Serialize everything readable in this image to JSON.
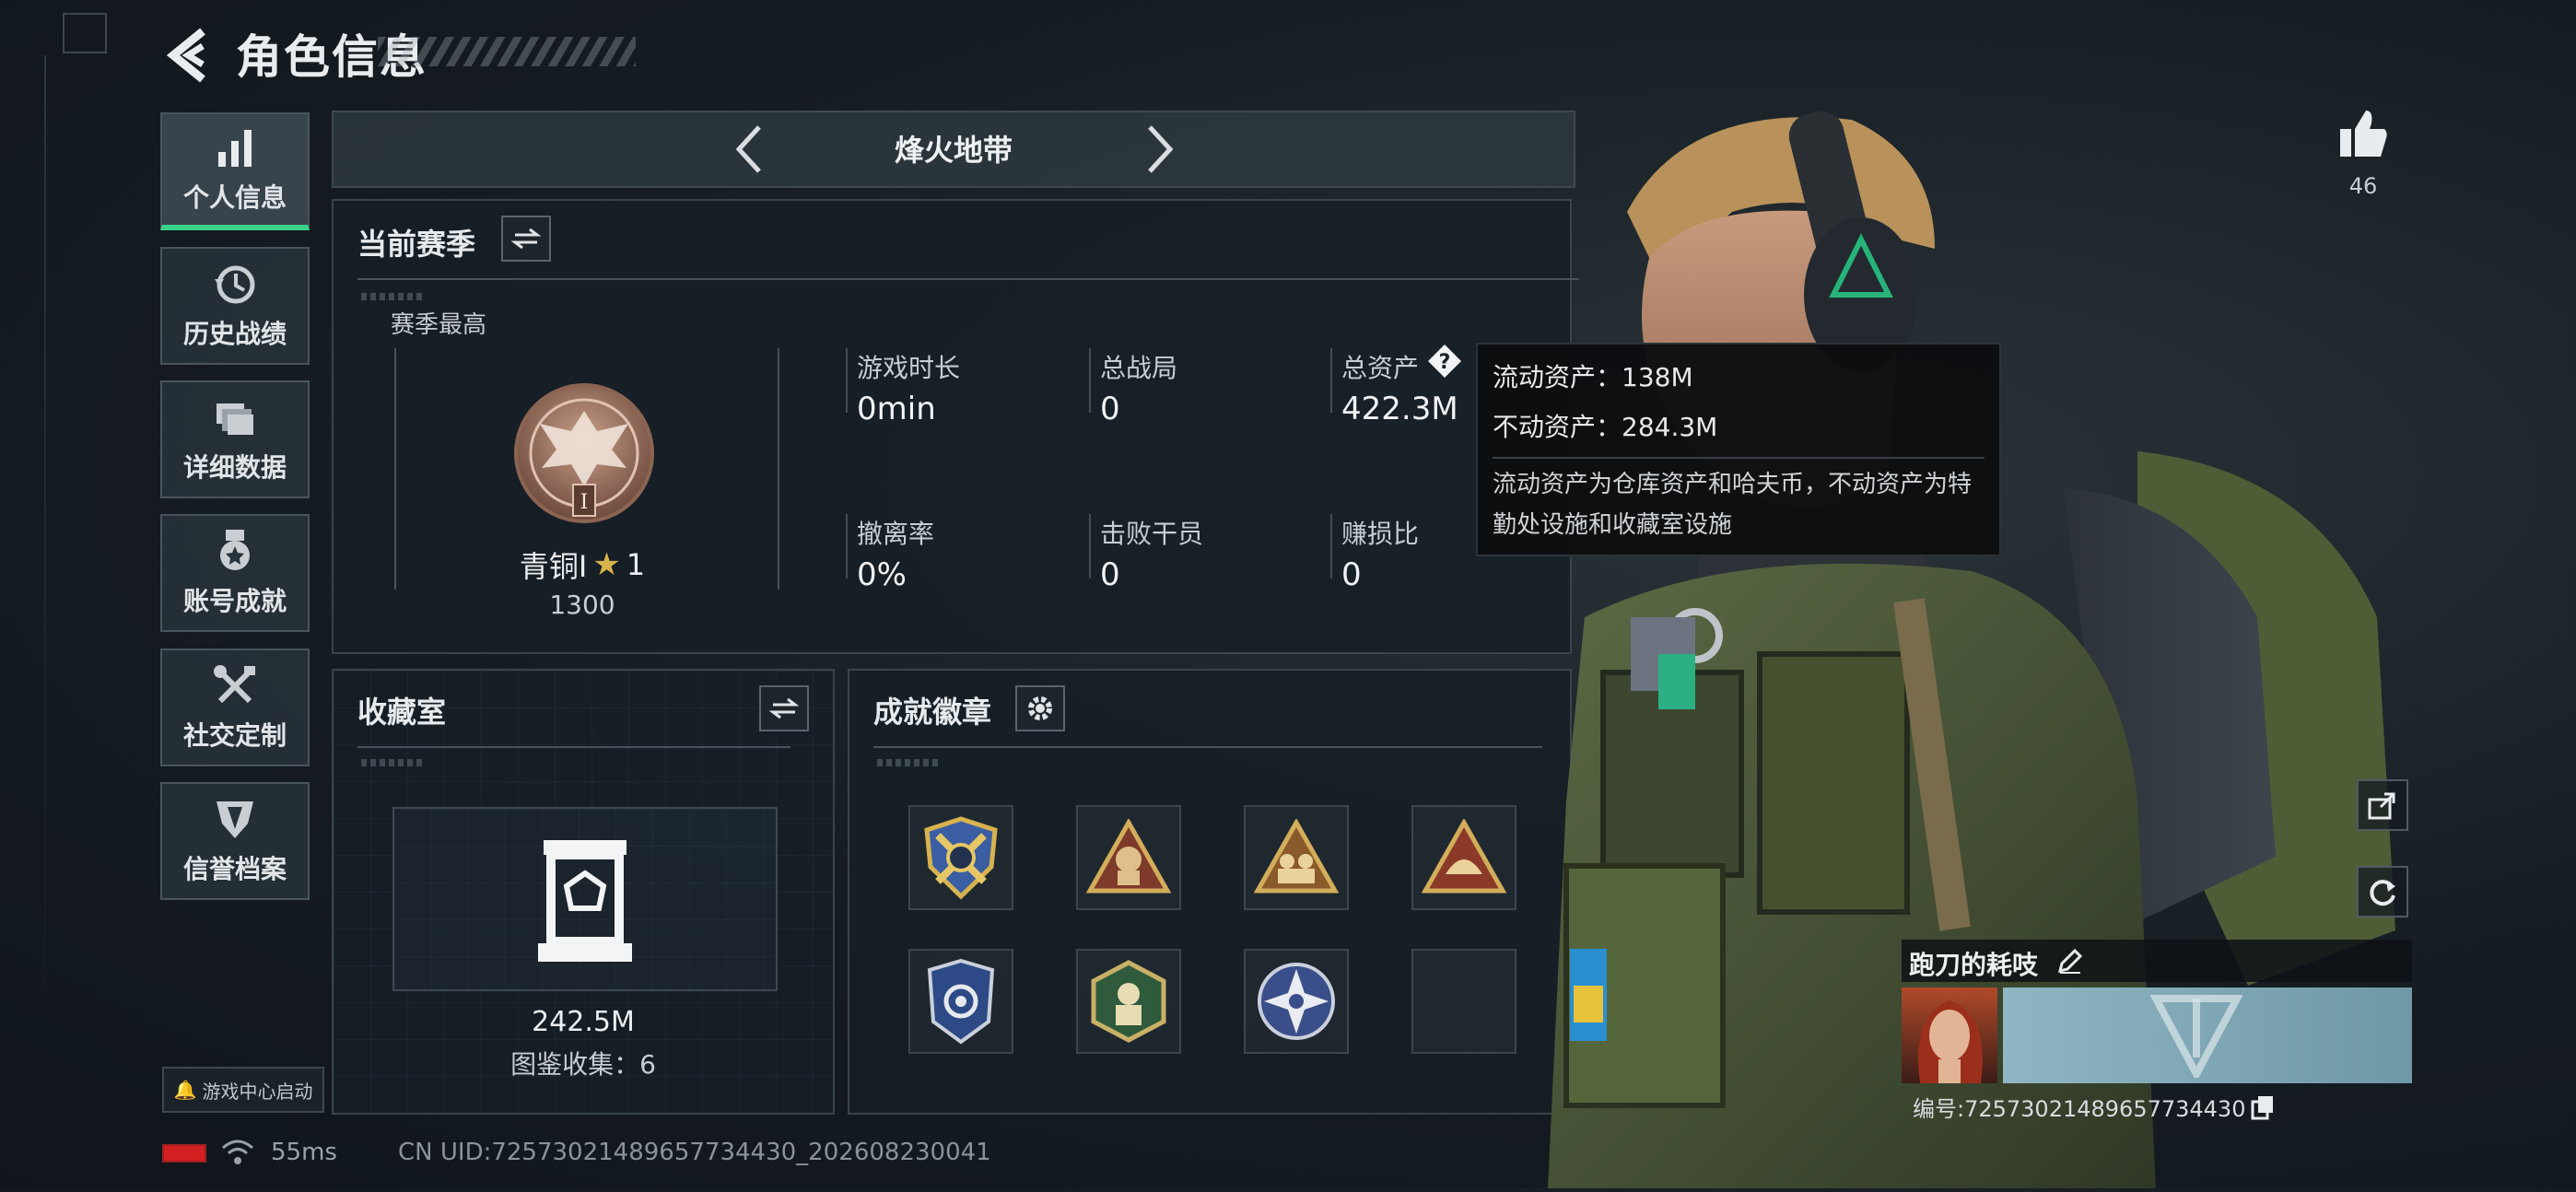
{
  "header": {
    "title": "角色信息"
  },
  "nav": {
    "items": [
      {
        "label": "个人信息",
        "icon": "bar-chart-icon",
        "active": true
      },
      {
        "label": "历史战绩",
        "icon": "clock-history-icon",
        "active": false
      },
      {
        "label": "详细数据",
        "icon": "folders-icon",
        "active": false
      },
      {
        "label": "账号成就",
        "icon": "medal-icon",
        "active": false
      },
      {
        "label": "社交定制",
        "icon": "tools-icon",
        "active": false
      },
      {
        "label": "信誉档案",
        "icon": "shield-emblem-icon",
        "active": false
      }
    ],
    "game_center": "游戏中心启动"
  },
  "mode": {
    "label": "烽火地带"
  },
  "season": {
    "title": "当前赛季",
    "best_label": "赛季最高",
    "rank_name": "青铜Ⅰ",
    "rank_stars": "1",
    "rank_score": "1300",
    "rank_numeral": "I",
    "stats": [
      {
        "label": "游戏时长",
        "value": "0min"
      },
      {
        "label": "总战局",
        "value": "0"
      },
      {
        "label": "总资产",
        "value": "422.3M"
      },
      {
        "label": "撤离率",
        "value": "0%"
      },
      {
        "label": "击败干员",
        "value": "0"
      },
      {
        "label": "赚损比",
        "value": "0"
      }
    ]
  },
  "tooltip": {
    "liquid": "流动资产：138M",
    "fixed": "不动资产：284.3M",
    "desc": "流动资产为仓库资产和哈夫币，不动资产为特勤处设施和收藏室设施"
  },
  "collection": {
    "title": "收藏室",
    "value": "242.5M",
    "count": "图鉴收集：6"
  },
  "badges": {
    "title": "成就徽章",
    "items": [
      {
        "icon": "shield-crossed-badge-icon"
      },
      {
        "icon": "triangle-hooded-badge-icon"
      },
      {
        "icon": "triangle-soldiers-badge-icon"
      },
      {
        "icon": "triangle-helmet-badge-icon"
      },
      {
        "icon": "police-shield-badge-icon"
      },
      {
        "icon": "hexagon-medic-badge-icon"
      },
      {
        "icon": "star-compass-badge-icon"
      },
      {
        "icon": "empty-slot"
      }
    ]
  },
  "profile": {
    "likes": "46",
    "nickname": "跑刀的耗吱",
    "id_line": "编号:7257302148965773443​0"
  },
  "status": {
    "ping": "55ms",
    "uid": "CN UID:7257302148965773443​0_202608230041"
  },
  "colors": {
    "accent_green": "#39d38b",
    "battery_red": "#d21f1f",
    "gold": "#c9a44a"
  }
}
